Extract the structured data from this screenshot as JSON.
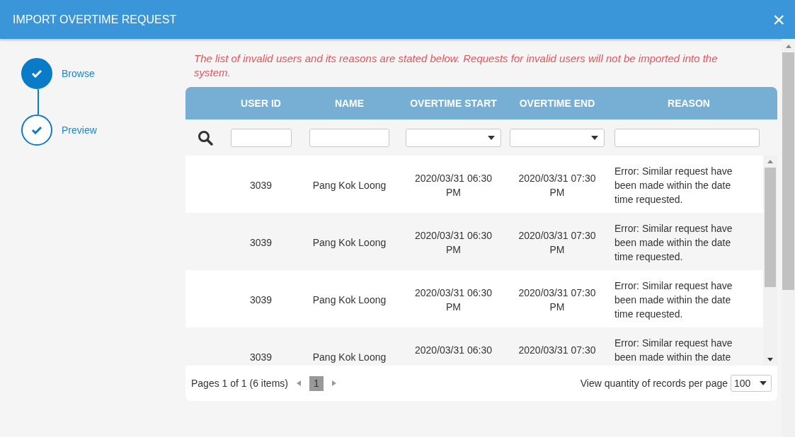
{
  "window": {
    "title": "IMPORT OVERTIME REQUEST",
    "close": "×"
  },
  "steps": [
    {
      "label": "Browse",
      "selected": true
    },
    {
      "label": "Preview",
      "selected": false
    }
  ],
  "message": "The list of invalid users and its reasons are stated below. Requests for invalid users will not be imported into the system.",
  "table": {
    "columns": [
      "USER ID",
      "NAME",
      "OVERTIME START",
      "OVERTIME END",
      "REASON"
    ],
    "filters": [
      {
        "kind": "text"
      },
      {
        "kind": "text"
      },
      {
        "kind": "select"
      },
      {
        "kind": "select"
      },
      {
        "kind": "text"
      }
    ],
    "rows": [
      [
        "3039",
        "Pang Kok Loong",
        "2020/03/31 06:30 PM",
        "2020/03/31 07:30 PM",
        "Error: Similar request have been made within the date time requested."
      ],
      [
        "3039",
        "Pang Kok Loong",
        "2020/03/31 06:30 PM",
        "2020/03/31 07:30 PM",
        "Error: Similar request have been made within the date time requested."
      ],
      [
        "3039",
        "Pang Kok Loong",
        "2020/03/31 06:30 PM",
        "2020/03/31 07:30 PM",
        "Error: Similar request have been made within the date time requested."
      ],
      [
        "3039",
        "Pang Kok Loong",
        "2020/03/31 06:30",
        "2020/03/31 07:30",
        "Error: Similar request have been made within the date"
      ]
    ]
  },
  "pager": {
    "summary": "Pages 1 of 1 (6 items)",
    "pages": [
      {
        "label": "1",
        "selected": true
      }
    ],
    "size_label": "View quantity of records per page",
    "size": "100"
  }
}
